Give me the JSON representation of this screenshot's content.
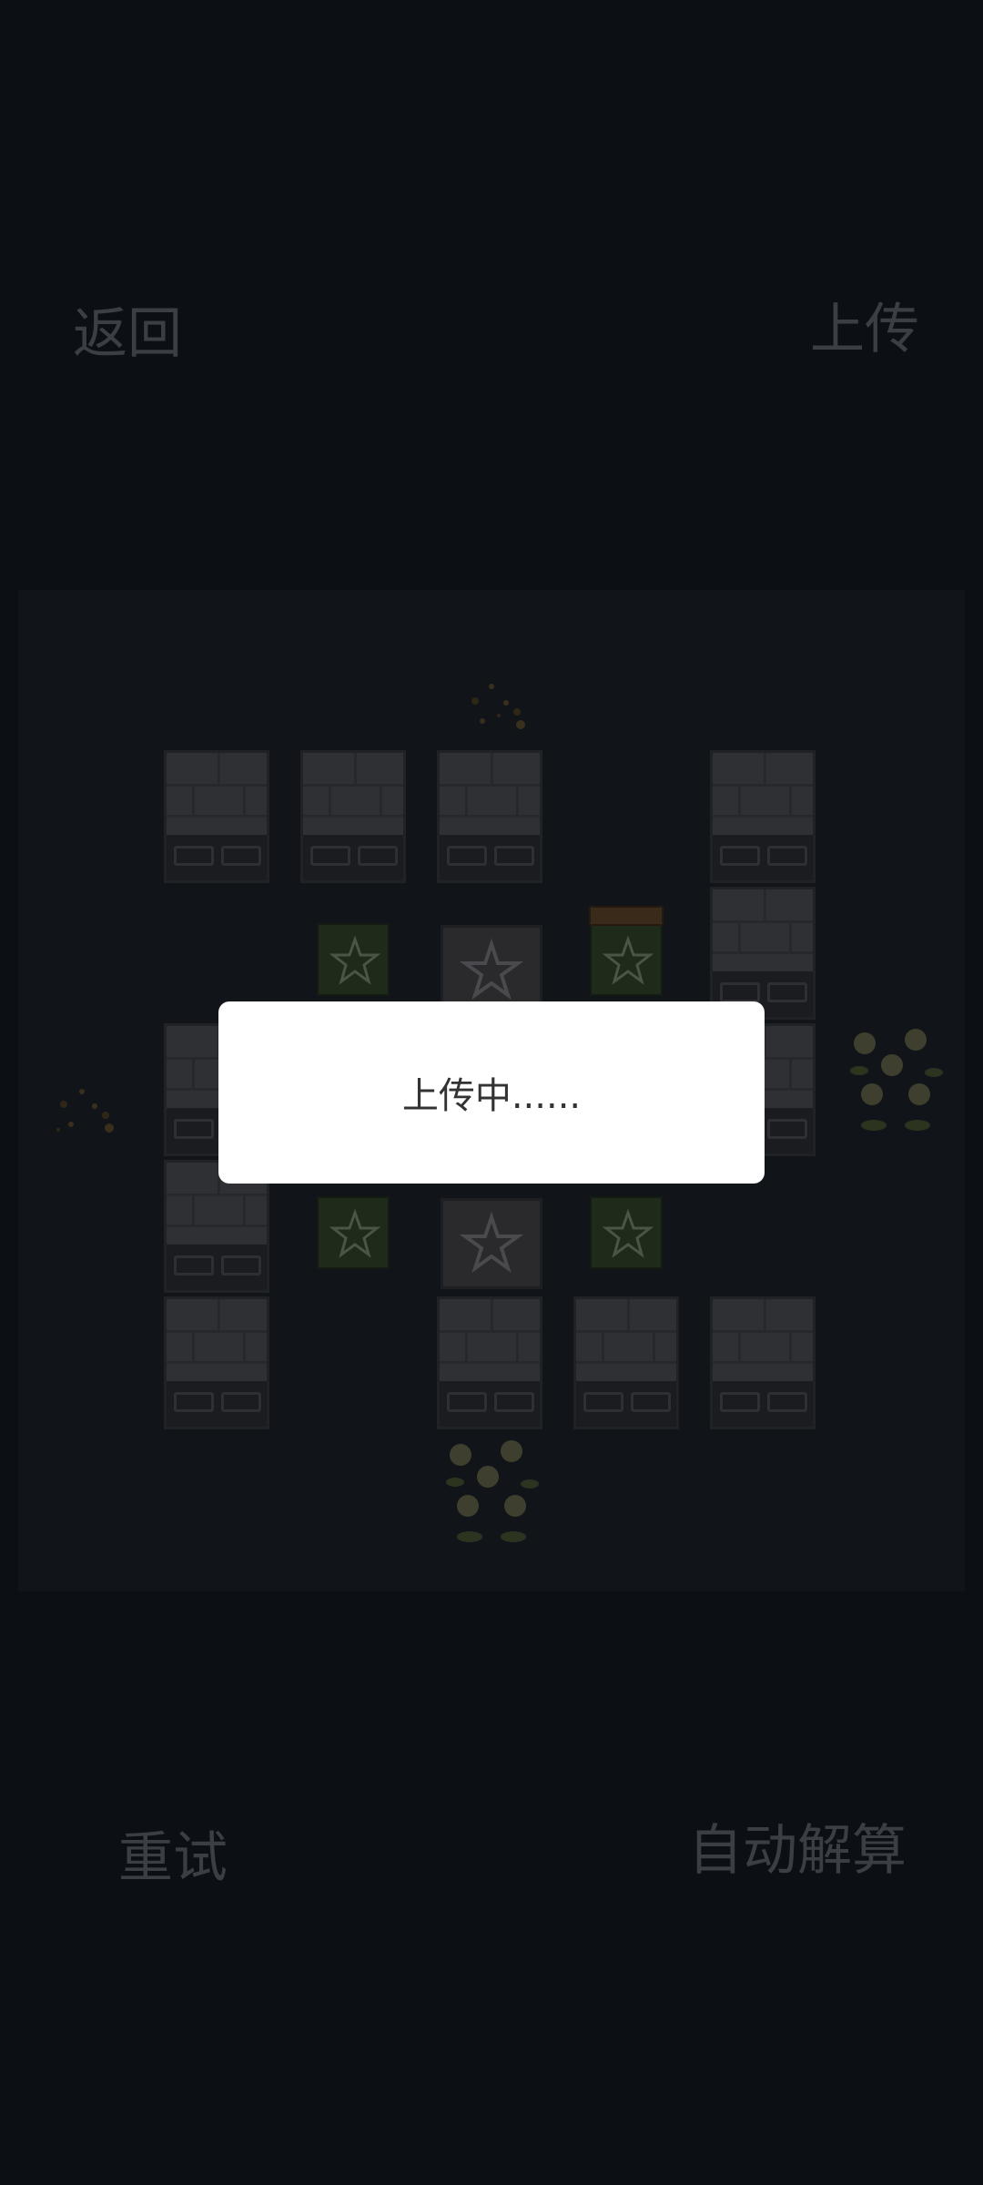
{
  "header": {
    "back_label": "返回",
    "upload_label": "上传"
  },
  "footer": {
    "retry_label": "重试",
    "auto_solve_label": "自动解算"
  },
  "dialog": {
    "message": "上传中......"
  },
  "colors": {
    "background": "#0c0f14",
    "board": "#111419",
    "muted_text": "#3b3f45",
    "dialog_bg": "#ffffff",
    "dialog_text": "#333333"
  }
}
